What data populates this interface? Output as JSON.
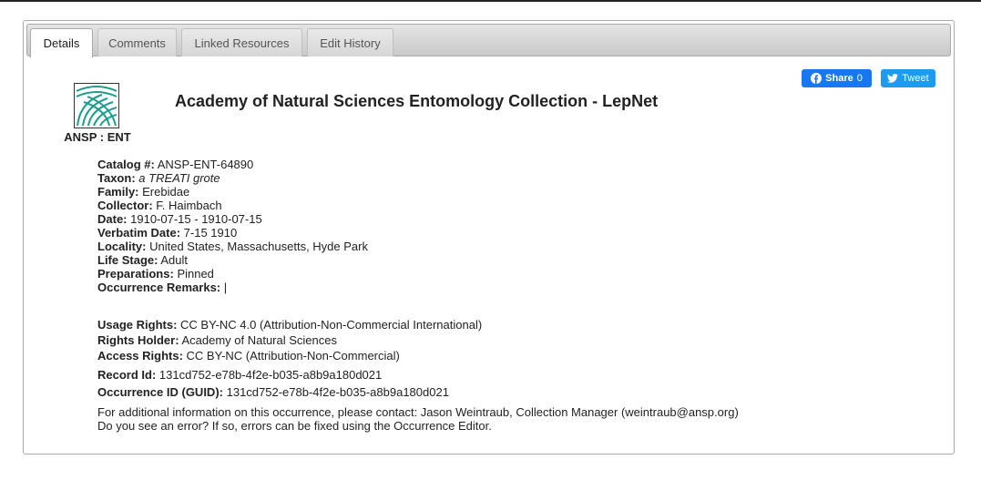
{
  "tabs": [
    {
      "label": "Details"
    },
    {
      "label": "Comments"
    },
    {
      "label": "Linked Resources"
    },
    {
      "label": "Edit History"
    }
  ],
  "collection": {
    "code": "ANSP : ENT",
    "title": "Academy of Natural Sciences Entomology Collection - LepNet"
  },
  "share": {
    "facebook_label": "Share",
    "facebook_count": "0",
    "tweet_label": "Tweet"
  },
  "fields": [
    {
      "label": "Catalog #:",
      "value": "ANSP-ENT-64890"
    },
    {
      "label": "Taxon:",
      "value": "a TREATI grote"
    },
    {
      "label": "Family:",
      "value": "Erebidae"
    },
    {
      "label": "Collector:",
      "value": "F. Haimbach"
    },
    {
      "label": "Date:",
      "value": "1910-07-15 - 1910-07-15"
    },
    {
      "label": "Verbatim Date:",
      "value": "7-15 1910"
    },
    {
      "label": "Locality:",
      "value": "United States, Massachusetts, Hyde Park"
    },
    {
      "label": "Life Stage:",
      "value": "Adult"
    },
    {
      "label": "Preparations:",
      "value": "Pinned"
    },
    {
      "label": "Occurrence Remarks:",
      "value": "|"
    }
  ],
  "rights": [
    {
      "label": "Usage Rights:",
      "value": "CC BY-NC 4.0 (Attribution-Non-Commercial International)"
    },
    {
      "label": "Rights Holder:",
      "value": "Academy of Natural Sciences"
    },
    {
      "label": "Access Rights:",
      "value": "CC BY-NC (Attribution-Non-Commercial)"
    }
  ],
  "record": [
    {
      "label": "Record Id:",
      "value": "131cd752-e78b-4f2e-b035-a8b9a180d021"
    },
    {
      "label": "Occurrence ID (GUID):",
      "value": "131cd752-e78b-4f2e-b035-a8b9a180d021"
    }
  ],
  "contact": {
    "line1": "For additional information on this occurrence, please contact: Jason Weintraub, Collection Manager (weintraub@ansp.org)",
    "line2": "Do you see an error? If so, errors can be fixed using the Occurrence Editor."
  },
  "colors": {
    "logo": "#1b9e8f",
    "facebook": "#1877f2",
    "twitter": "#1d9bf0"
  }
}
